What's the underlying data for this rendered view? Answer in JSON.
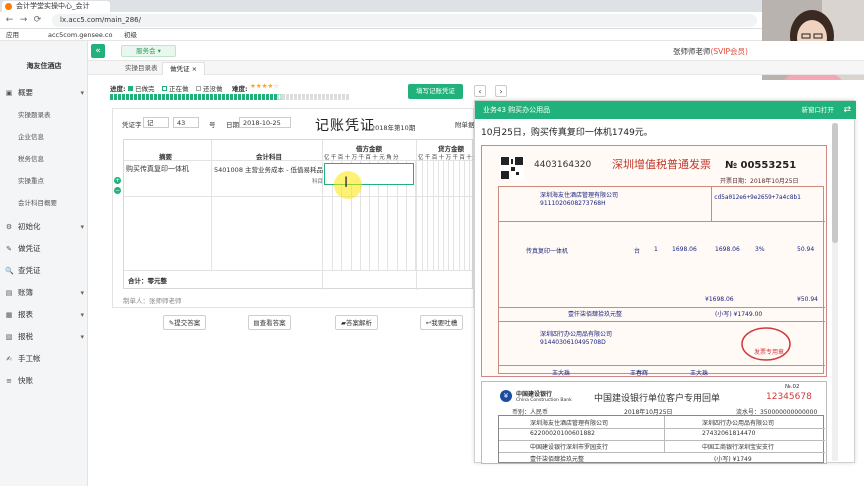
{
  "browser": {
    "tab_title": "会计学堂实操中心_会计",
    "url": "lx.acc5.com/main_286/",
    "bookmarks": [
      "应用",
      "acc5com.gensee.co",
      "初级"
    ]
  },
  "sidebar": {
    "brand": "海友住酒店",
    "items": [
      {
        "label": "概要",
        "icon": "▣",
        "expand": "▾"
      },
      {
        "label": "实操题录表"
      },
      {
        "label": "企业信息"
      },
      {
        "label": "税务信息"
      },
      {
        "label": "实操重点"
      },
      {
        "label": "会计科目概要"
      },
      {
        "label": "初始化",
        "icon": "⚙",
        "expand": "▾"
      },
      {
        "label": "做凭证",
        "icon": "✎"
      },
      {
        "label": "查凭证",
        "icon": "🔍"
      },
      {
        "label": "账簿",
        "icon": "▤",
        "expand": "▾"
      },
      {
        "label": "报表",
        "icon": "▦",
        "expand": "▾"
      },
      {
        "label": "报税",
        "icon": "▧",
        "expand": "▾"
      },
      {
        "label": "手工帐",
        "icon": "✍"
      },
      {
        "label": "快账",
        "icon": "≡"
      }
    ]
  },
  "topbar": {
    "collapse_icon": "«",
    "business": "服务会 ▾",
    "teacher": "张师师老师",
    "vip": "(SVIP会员)"
  },
  "page_tabs": [
    "实操目录表",
    "做凭证 ×"
  ],
  "progress": {
    "label": "进度:",
    "done": "已做完",
    "doing": "正在做",
    "todo": "还没做",
    "difficulty": "难度:",
    "difficulty_value": "★★★★☆"
  },
  "fill_voucher_button": "填写记账凭证",
  "voucher": {
    "word_label": "凭证字",
    "word_value": "记",
    "number": "43",
    "number_suffix": "号",
    "date_label": "日期",
    "date": "2018-10-25",
    "title": "记账凭证",
    "period": "2018年第10期",
    "attach": "附单据",
    "col_summary": "摘要",
    "col_account": "会计科目",
    "col_debit": "借方金额",
    "col_credit": "贷方金额",
    "digits": "亿千百十万千百十元角分",
    "row_summary": "购买传真复印一体机",
    "row_account": "5401008 主营业务成本 - 低值易耗品",
    "row_account_sub": "科目",
    "total": "合计：零元整",
    "maker": "制单人：张师师老师",
    "buttons": [
      "提交答案",
      "查看答案",
      "答案解析",
      "我要吐槽"
    ]
  },
  "panel": {
    "header": "业务43 购买办公用品",
    "open_new": "新窗口打开",
    "desc": "10月25日，购买传真复印一体机1749元。",
    "invoice": {
      "code": "4403164320",
      "title": "深圳增值税普通发票",
      "no": "№ 00553251",
      "no_side": "4403164320\n00553251",
      "date": "开票日期：2018年10月25日",
      "buyer": "深圳海友住酒店管理有限公司",
      "buyer_tax": "911102060827376​8H",
      "cipher": "cd5a012e6+9e2659+7a4c8b1",
      "item": "传真复印一体机",
      "qty": "台",
      "unit": "1",
      "price": "1698.06",
      "amount": "1698.06",
      "rate": "3%",
      "tax": "50.94",
      "sum_amount": "¥1698.06",
      "sum_tax": "¥50.94",
      "total_words": "壹仟柒佰肆拾玖元整",
      "total": "(小写) ¥1749.00",
      "seller": "深圳四行办公用品有限公司",
      "seller_tax": "914403061049570​8D",
      "payee": "王大珠",
      "checker": "王春辉",
      "drawer": "王大珠",
      "seal": "发票专用章"
    },
    "bank": {
      "bank_name": "中国建设银行",
      "bank_en": "China Construction Bank",
      "title": "中国建设银行单位客户专用回单",
      "serial": "12345678",
      "no_label": "№.02",
      "currency": "币别：人民币",
      "date": "2018年10月25日",
      "flow": "流水号：350000000000000",
      "payer_name": "深圳海友住酒店管理有限公司",
      "payer_acct": "622000201006​01882",
      "payer_bank": "中国建设银行深圳市罗园支行",
      "payee_name": "深圳四行办公用品有限公司",
      "payee_acct": "27432061814470",
      "payee_bank": "中国工商银行深圳宝安支行",
      "amount_words": "壹仟柒佰肆拾玖元整",
      "amount": "(小写) ¥1749"
    }
  }
}
